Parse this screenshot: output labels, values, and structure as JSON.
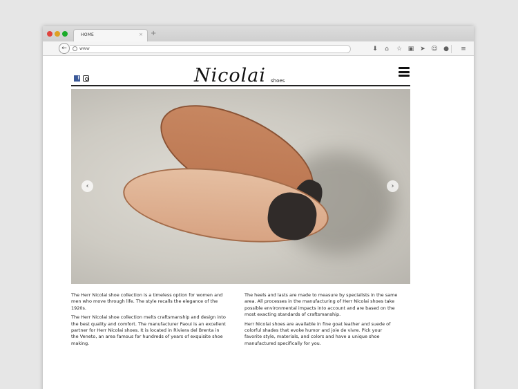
{
  "browser": {
    "tab_title": "HOME",
    "tab_close": "×",
    "new_tab": "+",
    "back": "←",
    "url": "www",
    "toolbar_icons": [
      "download-icon",
      "home-icon",
      "star-icon",
      "clipboard-icon",
      "send-icon",
      "smiley-icon",
      "chat-icon",
      "menu-icon"
    ]
  },
  "site": {
    "logo_script": "Nicolai",
    "logo_sub": "shoes",
    "social": [
      "facebook-icon",
      "instagram-icon"
    ],
    "slider": {
      "prev": "‹",
      "next": "›"
    },
    "paragraphs_left": [
      "The Herr Nicolai shoe collection is a timeless option for women and men who move through life. The style recalls the elegance of the 1920s.",
      "The Herr Nicolai shoe collection melts craftsmanship and design into the best quality and comfort. The manufacturer Paoui is an excellent partner for Herr Nicolai shoes. It is located in Riviera del Brenta in the Veneto, an area famous for hundreds of years of exquisite shoe making."
    ],
    "paragraphs_right": [
      "The heels and lasts are made to measure by specialists in the same area. All processes in the manufacturing of Herr Nicolai shoes take possible environmental impacts into account and are based on the most exacting standards of craftsmanship.",
      "Herr Nicolai shoes are available in fine goat leather and suede of colorful shades that evoke humor and joie de vivre. Pick your favorite style, materials, and colors and have a unique shoe manufactured specifically for you."
    ]
  }
}
